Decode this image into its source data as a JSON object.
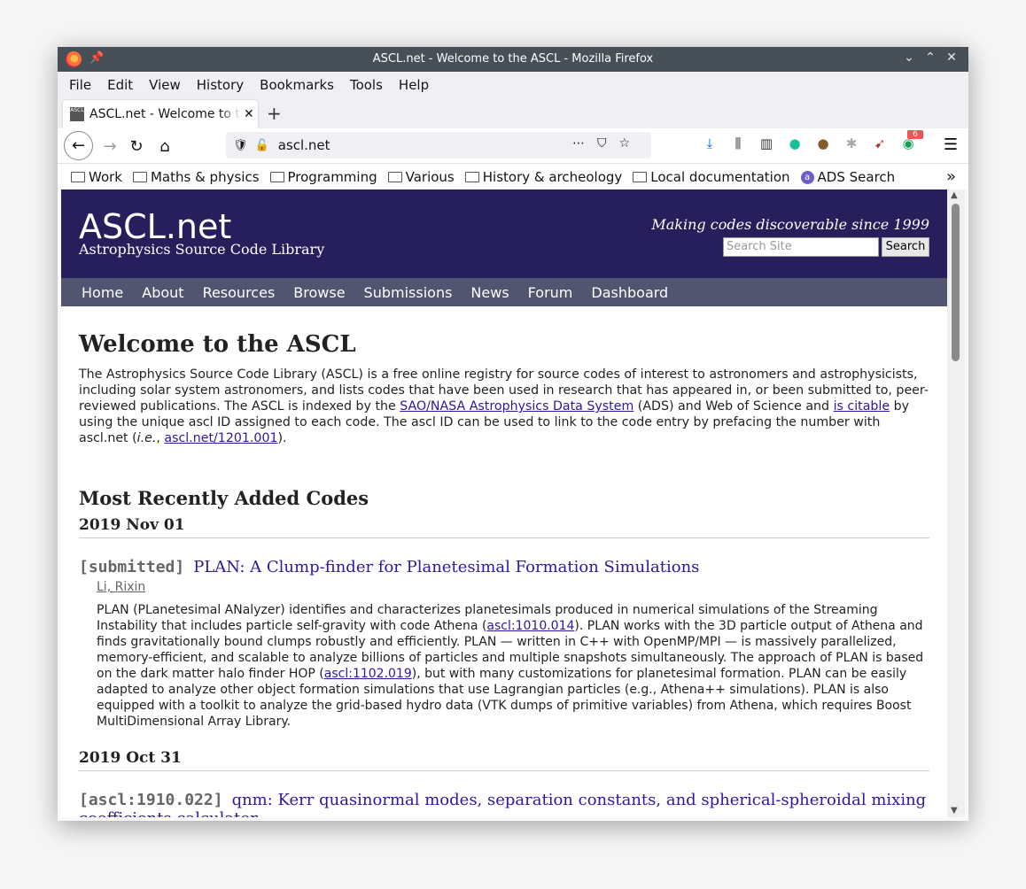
{
  "window": {
    "title": "ASCL.net - Welcome to the ASCL - Mozilla Firefox"
  },
  "menu": [
    "File",
    "Edit",
    "View",
    "History",
    "Bookmarks",
    "Tools",
    "Help"
  ],
  "tab": {
    "label": "ASCL.net - Welcome to the ASCL"
  },
  "urlbar": {
    "url": "ascl.net"
  },
  "toolbar": {
    "badge_count": "6"
  },
  "bookmarks": [
    "Work",
    "Maths & physics",
    "Programming",
    "Various",
    "History & archeology",
    "Local documentation"
  ],
  "bookmark_ads": "ADS Search",
  "site": {
    "logo": "ASCL.net",
    "subtitle": "Astrophysics Source Code Library",
    "tagline": "Making codes discoverable since 1999",
    "search_placeholder": "Search Site",
    "search_button": "Search",
    "nav": [
      "Home",
      "About",
      "Resources",
      "Browse",
      "Submissions",
      "News",
      "Forum",
      "Dashboard"
    ]
  },
  "page": {
    "heading": "Welcome to the ASCL",
    "intro_1": "The Astrophysics Source Code Library (ASCL) is a free online registry for source codes of interest to astronomers and astrophysicists, including solar system astronomers, and lists codes that have been used in research that has appeared in, or been submitted to, peer-reviewed publications. The ASCL is indexed by the ",
    "intro_link_ads": "SAO/NASA Astrophysics Data System",
    "intro_2": " (ADS) and Web of Science and ",
    "intro_link_citable": "is citable",
    "intro_3": " by using the unique ascl ID assigned to each code. The ascl ID can be used to link to the code entry by prefacing the number with ascl.net (",
    "intro_ie": "i.e.",
    "intro_4": ", ",
    "intro_link_example": "ascl.net/1201.001",
    "intro_5": ").",
    "recent_heading": "Most Recently Added Codes",
    "date_1": "2019 Nov 01",
    "entry_1": {
      "tag": "[submitted]",
      "title": "PLAN: A Clump-finder for Planetesimal Formation Simulations",
      "author": "Li, Rixin",
      "abs_1": "PLAN (PLanetesimal ANalyzer) identifies and characterizes planetesimals produced in numerical simulations of the Streaming Instability that includes particle self-gravity with code Athena (",
      "abs_link_1": "ascl:1010.014",
      "abs_2": "). PLAN works with the 3D particle output of Athena and finds gravitationally bound clumps robustly and efficiently. PLAN — written in C++ with OpenMP/MPI — is massively parallelized, memory-efficient, and scalable to analyze billions of particles and multiple snapshots simultaneously. The approach of PLAN is based on the dark matter halo finder HOP (",
      "abs_link_2": "ascl:1102.019",
      "abs_3": "), but with many customizations for planetesimal formation. PLAN can be easily adapted to analyze other object formation simulations that use Lagrangian particles (e.g., Athena++ simulations). PLAN is also equipped with a toolkit to analyze the grid-based hydro data (VTK dumps of primitive variables) from Athena, which requires Boost MultiDimensional Array Library."
    },
    "date_2": "2019 Oct 31",
    "entry_2": {
      "tag": "[ascl:1910.022]",
      "title": "qnm: Kerr quasinormal modes, separation constants, and spherical-spheroidal mixing coefficients calculator"
    }
  }
}
